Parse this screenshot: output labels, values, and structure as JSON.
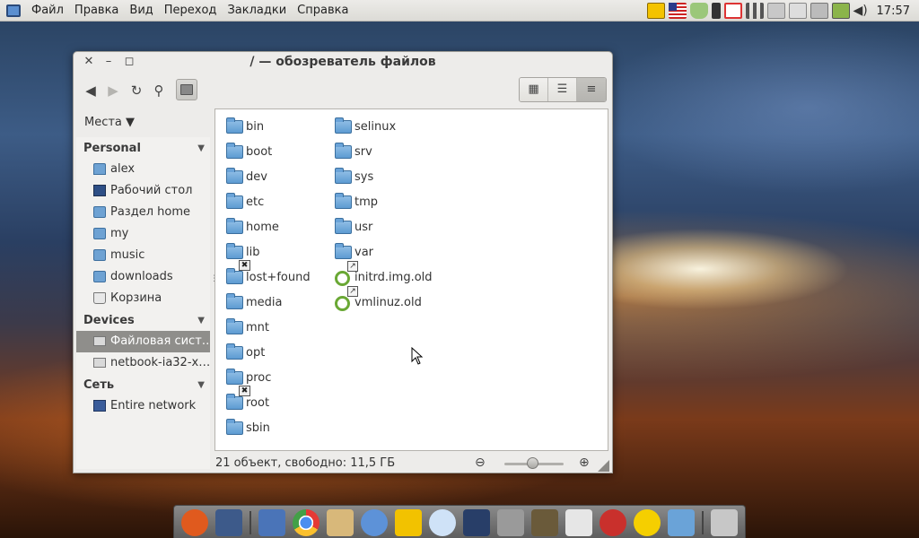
{
  "top_panel": {
    "menu": [
      {
        "label": "Файл"
      },
      {
        "label": "Правка"
      },
      {
        "label": "Вид"
      },
      {
        "label": "Переход"
      },
      {
        "label": "Закладки"
      },
      {
        "label": "Справка"
      }
    ],
    "tray_icons": [
      "bird-icon",
      "us-flag-icon",
      "shield-icon",
      "clipboard-icon",
      "gmail-icon",
      "signal-icon",
      "monitor-icon",
      "monitor-icon",
      "monitor-icon",
      "battery-icon",
      "volume-icon"
    ],
    "clock": "17:57"
  },
  "window": {
    "title": "/ — обозреватель файлов",
    "places_label": "Места",
    "sidebar": {
      "sections": [
        {
          "label": "Personal"
        },
        {
          "label": "Devices"
        },
        {
          "label": "Сеть"
        }
      ],
      "personal": [
        {
          "label": "alex",
          "icon": "home-folder-icon"
        },
        {
          "label": "Рабочий стол",
          "icon": "desktop-icon"
        },
        {
          "label": "Раздел home",
          "icon": "folder-icon"
        },
        {
          "label": "my",
          "icon": "folder-icon"
        },
        {
          "label": "music",
          "icon": "folder-icon"
        },
        {
          "label": "downloads",
          "icon": "folder-icon"
        },
        {
          "label": "Корзина",
          "icon": "trash-icon"
        }
      ],
      "devices": [
        {
          "label": "Файловая сист…",
          "icon": "drive-icon",
          "selected": true
        },
        {
          "label": "netbook-ia32-x…",
          "icon": "drive-icon"
        }
      ],
      "network": [
        {
          "label": "Entire network",
          "icon": "network-icon"
        }
      ]
    },
    "files_col1": [
      {
        "name": "bin"
      },
      {
        "name": "boot"
      },
      {
        "name": "dev"
      },
      {
        "name": "etc"
      },
      {
        "name": "home"
      },
      {
        "name": "lib"
      },
      {
        "name": "lost+found",
        "locked": true
      },
      {
        "name": "media"
      },
      {
        "name": "mnt"
      },
      {
        "name": "opt"
      },
      {
        "name": "proc"
      },
      {
        "name": "root",
        "locked": true
      },
      {
        "name": "sbin"
      }
    ],
    "files_col2": [
      {
        "name": "selinux"
      },
      {
        "name": "srv"
      },
      {
        "name": "sys"
      },
      {
        "name": "tmp"
      },
      {
        "name": "usr"
      },
      {
        "name": "var"
      },
      {
        "name": "initrd.img.old",
        "link": true
      },
      {
        "name": "vmlinuz.old",
        "link": true
      }
    ],
    "status": "21 объект, свободно: 11,5 ГБ",
    "zoom_level": 0.5
  },
  "dock": {
    "icons": [
      "ubuntu-icon",
      "screenshot-icon",
      "documents-icon",
      "chrome-icon",
      "mail-icon",
      "pidgin-icon",
      "bird-icon",
      "cloud-download-icon",
      "tv-icon",
      "media-player-icon",
      "paint-icon",
      "calculator-icon",
      "angry-birds-icon",
      "radiation-icon",
      "folder-icon",
      "workspace-icon"
    ]
  }
}
